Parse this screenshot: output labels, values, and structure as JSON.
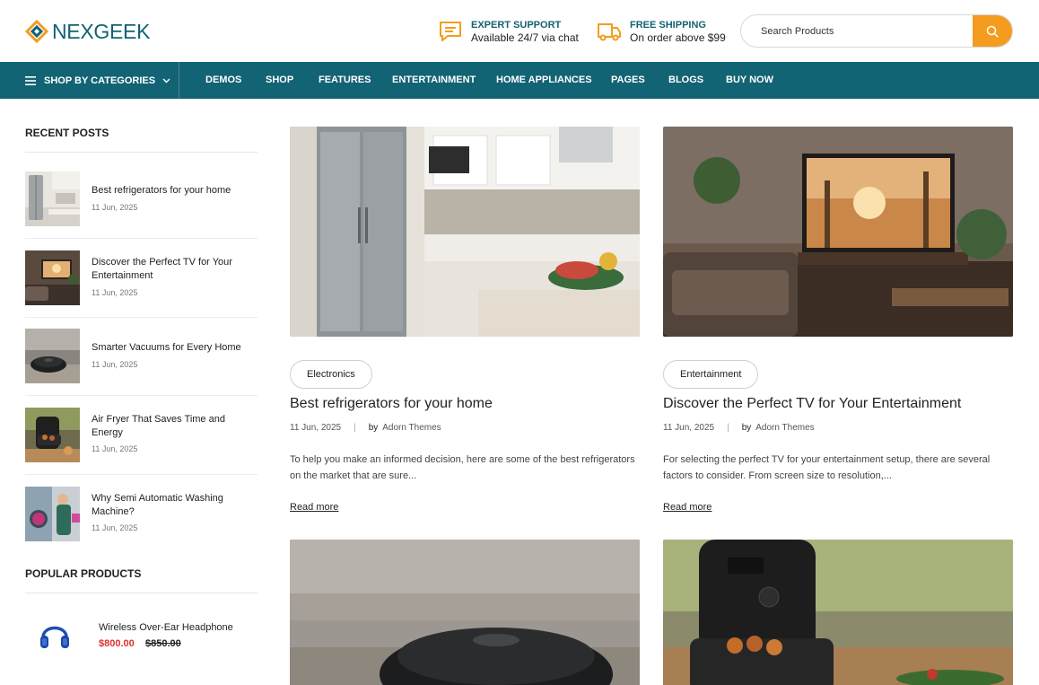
{
  "header": {
    "brand": "NEXGEEK",
    "support": {
      "title": "EXPERT SUPPORT",
      "subtitle": "Available 24/7 via chat"
    },
    "shipping": {
      "title": "FREE SHIPPING",
      "subtitle": "On order above $99"
    },
    "search": {
      "placeholder": "Search Products"
    },
    "accent_color": "#126373",
    "search_button_color": "#f39c1f"
  },
  "nav": {
    "categories_label": "SHOP BY CATEGORIES",
    "items": [
      "DEMOS",
      "SHOP",
      "FEATURES",
      "ENTERTAINMENT",
      "HOME APPLIANCES",
      "PAGES",
      "BLOGS",
      "BUY NOW"
    ]
  },
  "sidebar": {
    "recent_title": "RECENT POSTS",
    "recent_posts": [
      {
        "title": "Best refrigerators for your home",
        "date": "11 Jun, 2025"
      },
      {
        "title": "Discover the Perfect TV for Your Entertainment",
        "date": "11 Jun, 2025"
      },
      {
        "title": "Smarter Vacuums for Every Home",
        "date": "11 Jun, 2025"
      },
      {
        "title": "Air Fryer That Saves Time and Energy",
        "date": "11 Jun, 2025"
      },
      {
        "title": "Why Semi Automatic Washing Machine?",
        "date": "11 Jun, 2025"
      }
    ],
    "popular_title": "POPULAR PRODUCTS",
    "popular_products": [
      {
        "title": "Wireless Over-Ear Headphone",
        "price": "$800.00",
        "old_price": "$850.00"
      }
    ]
  },
  "posts": [
    {
      "category": "Electronics",
      "title": "Best refrigerators for your home",
      "date": "11 Jun, 2025",
      "sep": "|",
      "by": "by",
      "author": "Adorn Themes",
      "excerpt": "To help you make an informed decision, here are some of the best refrigerators on the market that are sure...",
      "read_more": "Read more"
    },
    {
      "category": "Entertainment",
      "title": "Discover the Perfect TV for Your Entertainment",
      "date": "11 Jun, 2025",
      "sep": "|",
      "by": "by",
      "author": "Adorn Themes",
      "excerpt": "For selecting the perfect TV for your entertainment setup, there are several factors to consider. From screen size to resolution,...",
      "read_more": "Read more"
    }
  ]
}
